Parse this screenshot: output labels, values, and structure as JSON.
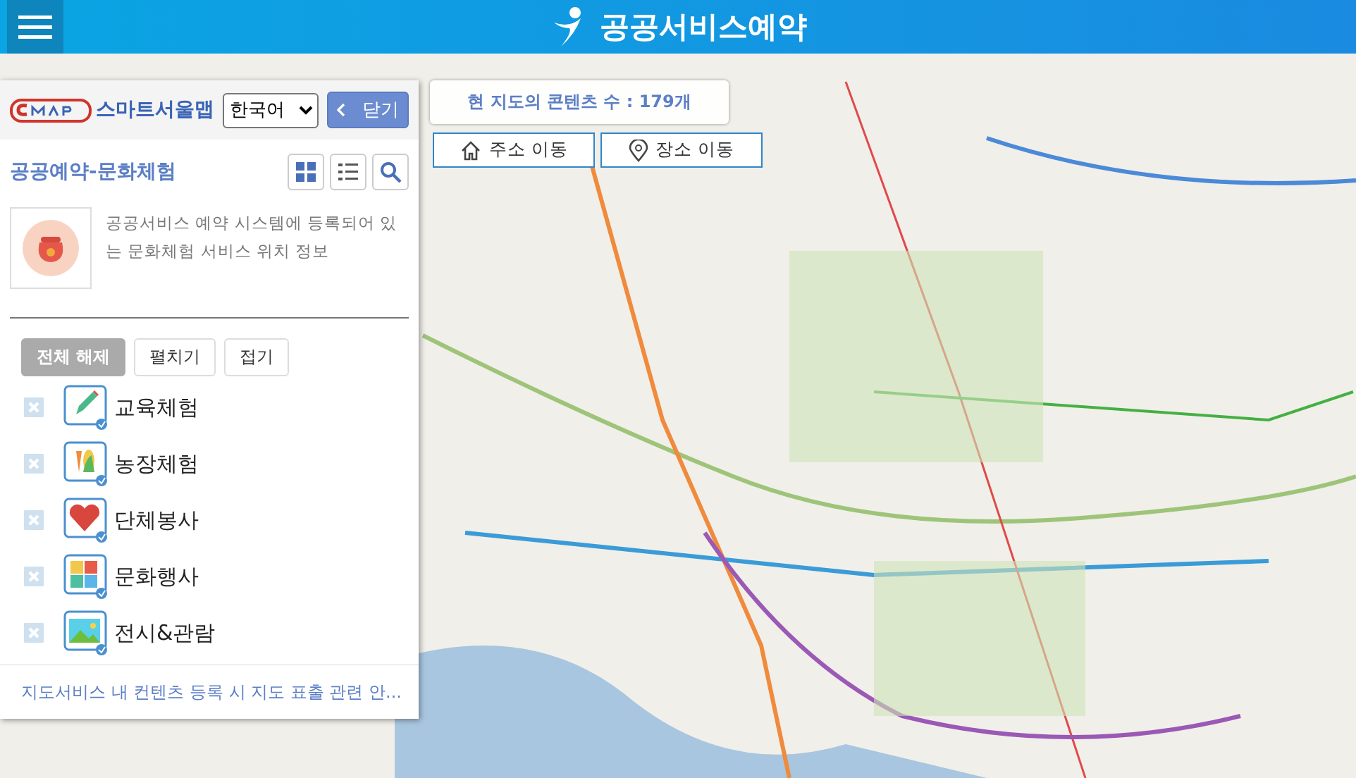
{
  "header": {
    "title": "공공서비스예약"
  },
  "panel": {
    "logo_text": "스마트서울맵",
    "language": "한국어",
    "close_button": "닫기",
    "title": "공공예약-문화체험",
    "description": "공공서비스 예약 시스템에 등록되어 있는 문화체험 서비스 위치 정보",
    "buttons": [
      {
        "label": "전체 해제",
        "selected": true
      },
      {
        "label": "펼치기",
        "selected": false
      },
      {
        "label": "접기",
        "selected": false
      }
    ],
    "categories": [
      {
        "label": "교육체험",
        "kind": "pencil",
        "checked": true
      },
      {
        "label": "농장체험",
        "kind": "produce",
        "checked": true
      },
      {
        "label": "단체봉사",
        "kind": "heart",
        "checked": true
      },
      {
        "label": "문화행사",
        "kind": "puzzle",
        "checked": true
      },
      {
        "label": "전시&관람",
        "kind": "picture",
        "checked": true
      }
    ],
    "footer_link": "지도서비스 내 컨텐츠 등록 시 지도 표출 관련 안..."
  },
  "map": {
    "content_count": "현 지도의 콘텐츠 수 : 179개",
    "buttons": [
      {
        "label": "주소 이동",
        "kind": "home"
      },
      {
        "label": "장소 이동",
        "kind": "pin"
      }
    ]
  }
}
